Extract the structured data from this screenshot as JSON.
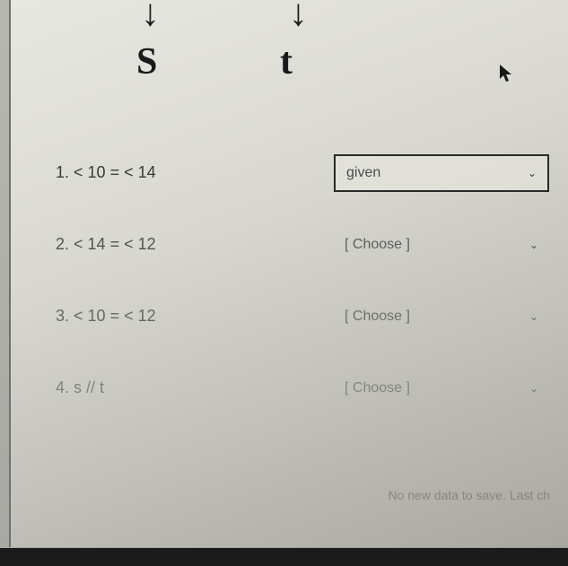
{
  "header": {
    "label_s": "S",
    "label_t": "t"
  },
  "proof": [
    {
      "num": "1.",
      "statement": "< 10 = < 14",
      "reason": "given",
      "boxed": true
    },
    {
      "num": "2.",
      "statement": "< 14 = < 12",
      "reason": "[ Choose ]",
      "boxed": false
    },
    {
      "num": "3.",
      "statement": "< 10 = < 12",
      "reason": "[ Choose ]",
      "boxed": false
    },
    {
      "num": "4.",
      "statement": "s // t",
      "reason": "[ Choose ]",
      "boxed": false
    }
  ],
  "footer": "No new data to save. Last ch"
}
